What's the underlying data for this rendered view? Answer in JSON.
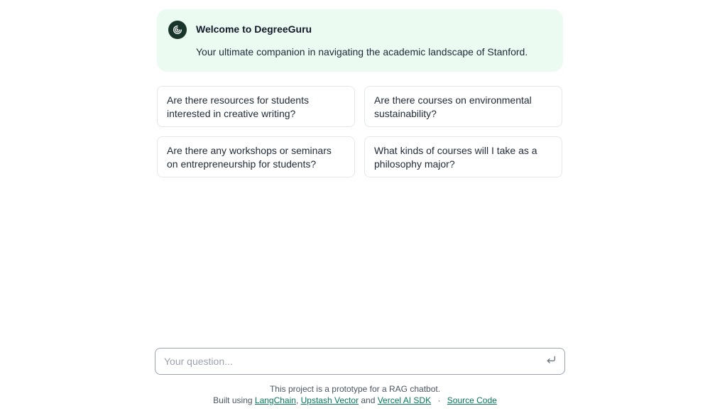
{
  "welcome": {
    "title": "Welcome to DegreeGuru",
    "subtitle": "Your ultimate companion in navigating the academic landscape of Stanford."
  },
  "suggestions": [
    {
      "text": "Are there resources for students interested in creative writing?"
    },
    {
      "text": "Are there courses on environmental sustainability?"
    },
    {
      "text": "Are there any workshops or seminars on entrepreneurship for students?"
    },
    {
      "text": "What kinds of courses will I take as a philosophy major?"
    }
  ],
  "input": {
    "placeholder": "Your question...",
    "value": ""
  },
  "footer": {
    "line1": "This project is a prototype for a RAG chatbot.",
    "built_using": "Built using",
    "links": {
      "langchain": "LangChain",
      "upstash": "Upstash Vector",
      "and": "and",
      "vercel": "Vercel AI SDK",
      "separator": "·",
      "source": "Source Code"
    }
  },
  "icons": {
    "logo": "openai-spiral-logo-icon",
    "submit": "enter-return-icon"
  },
  "colors": {
    "welcome_bg": "#ecfbf1",
    "logo_bg": "#17352a",
    "link": "#047857"
  }
}
